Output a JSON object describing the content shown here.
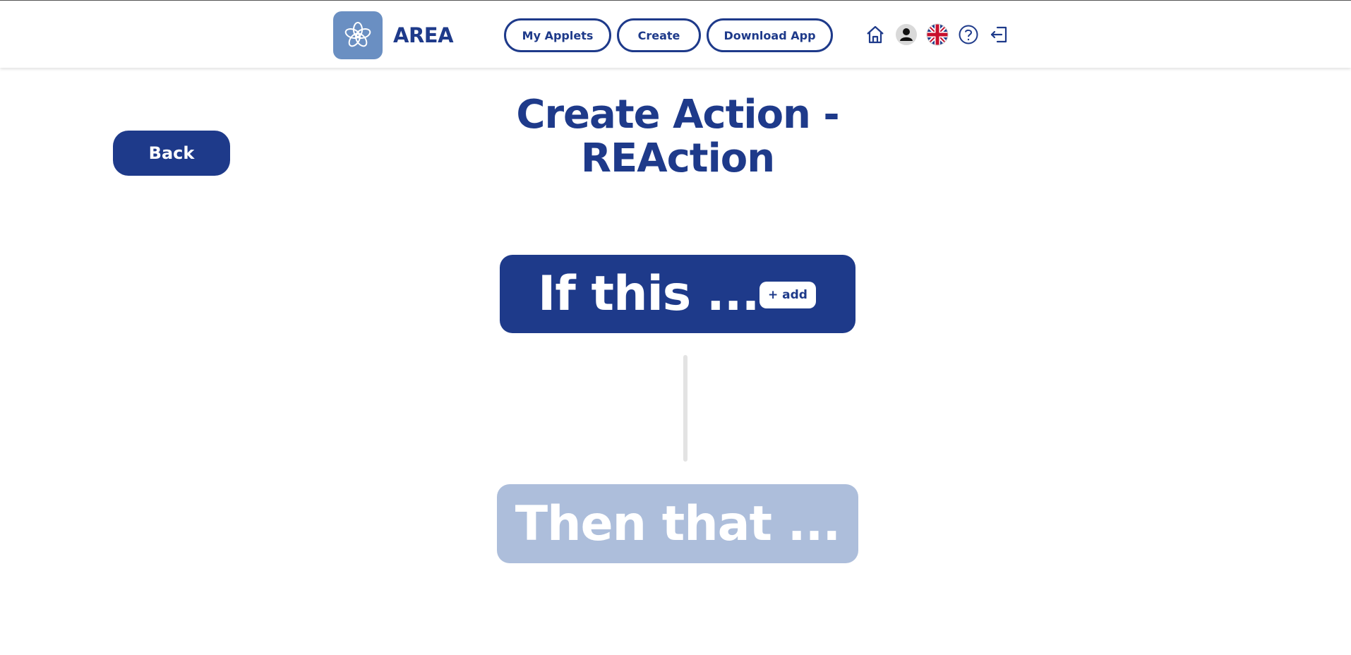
{
  "nav": {
    "brand": "AREA",
    "logo_icon": "flower-logo-icon",
    "links": [
      "My Applets",
      "Create",
      "Download App"
    ],
    "icons": [
      "home-icon",
      "user-avatar-icon",
      "uk-flag-icon",
      "help-icon",
      "logout-icon"
    ]
  },
  "page": {
    "back_label": "Back",
    "title_line1": "Create Action -",
    "title_line2": "REAction"
  },
  "trigger": {
    "label": "If this ...",
    "add_label": "+ add"
  },
  "reaction": {
    "label": "Then that ..."
  },
  "colors": {
    "primary": "#1e3a8a",
    "logo_bg": "#6a8fc2",
    "disabled_card": "#adbedb"
  }
}
